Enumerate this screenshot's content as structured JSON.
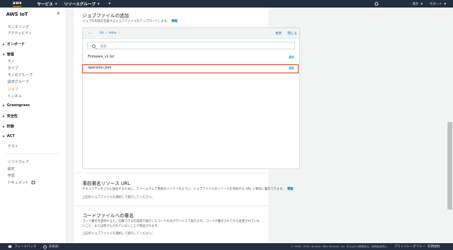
{
  "topnav": {
    "logo": "aws",
    "services": "サービス",
    "resource_groups": "リソースグループ",
    "account": "東京",
    "support": "サポート"
  },
  "sidebar": {
    "title": "AWS IoT",
    "items_top": [
      "モニタリング",
      "アクティビティ"
    ],
    "onboard": "オンボード",
    "manage": "管理",
    "manage_items": [
      "モノ",
      "タイプ",
      "モノのグループ",
      "請求グループ",
      "ジョブ",
      "トンネル"
    ],
    "greengrass": "Greengrass",
    "security": "安全性",
    "defend": "防御",
    "act": "ACT",
    "test": "テスト",
    "bottom_items": [
      "ソフトウェア",
      "設定",
      "学習",
      "ドキュメント"
    ]
  },
  "main": {
    "add_job": {
      "title": "ジョブファイルの追加",
      "desc": "ジョブの内容を定義するジョブファイルをアップロードします。",
      "info": "情報"
    },
    "s3": {
      "path": [
        "S3",
        "iotsa"
      ],
      "upload": "更新",
      "close": "閉じる",
      "search_placeholder": "検索",
      "files": [
        {
          "name": "Firmware_v1.txt",
          "action": "選択"
        },
        {
          "name": "operation.json",
          "action": "選択"
        }
      ]
    },
    "presign": {
      "title": "事前署名リソース URL",
      "desc": "セキュリティをさらに強化するために、ファームウェア更新のバイナリのように、ジョブファイルのリソースを参照する URL に事前に署名できます。",
      "info": "情報",
      "note": "上記のジョブファイルを選択して続行してください。"
    },
    "codesign": {
      "title": "コードファイルへの署名",
      "desc": "コード署名を使用すると、信頼できる作成者が発行したコードのみがデバイスで実行され、コードが署名されてから変更されていないこと、または改ざんされていないことが保証されます。",
      "note": "上記のジョブファイルを選択して続行してください。"
    }
  },
  "footer": {
    "feedback": "フィードバック",
    "language": "日本語",
    "copyright": "© 2008 - 2020, Amazon Web Services, Inc. またはその関連会社。無断転用禁止。",
    "privacy": "プライバシーポリシー",
    "terms": "利用規約"
  }
}
